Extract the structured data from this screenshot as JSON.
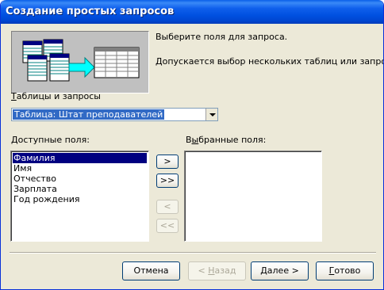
{
  "window": {
    "title": "Создание простых запросов"
  },
  "info": {
    "line1": "Выберите поля для запроса.",
    "line2": "Допускается выбор нескольких таблиц или запросов."
  },
  "tables": {
    "label_accel": "Т",
    "label_rest": "аблицы и запросы",
    "selected": "Таблица: Штат преподавателей"
  },
  "available": {
    "label_accel": "Д",
    "label_rest": "оступные поля:",
    "items": [
      "Фамилия",
      "Имя",
      "Отчество",
      "Зарплата",
      "Год рождения"
    ],
    "selected_index": 0
  },
  "selected_fields": {
    "label_pre": "В",
    "label_accel": "ы",
    "label_rest": "бранные поля:",
    "items": []
  },
  "move_buttons": {
    "add_one": ">",
    "add_all": ">>",
    "remove_one": "<",
    "remove_all": "<<"
  },
  "buttons": {
    "cancel": "Отмена",
    "back_accel": "Н",
    "back_pre": "< ",
    "back_rest": "азад",
    "next_accel": "Д",
    "next_rest": "алее >",
    "finish_accel": "Г",
    "finish_rest": "отово"
  },
  "colors": {
    "titlebar": "#0054e3",
    "face": "#ece9d8",
    "selection": "#000080",
    "combo_selection": "#316ac5",
    "disabled_text": "#aca899"
  },
  "icons": {
    "illustration": "tables-to-query-illustration",
    "dropdown": "chevron-down-icon"
  }
}
